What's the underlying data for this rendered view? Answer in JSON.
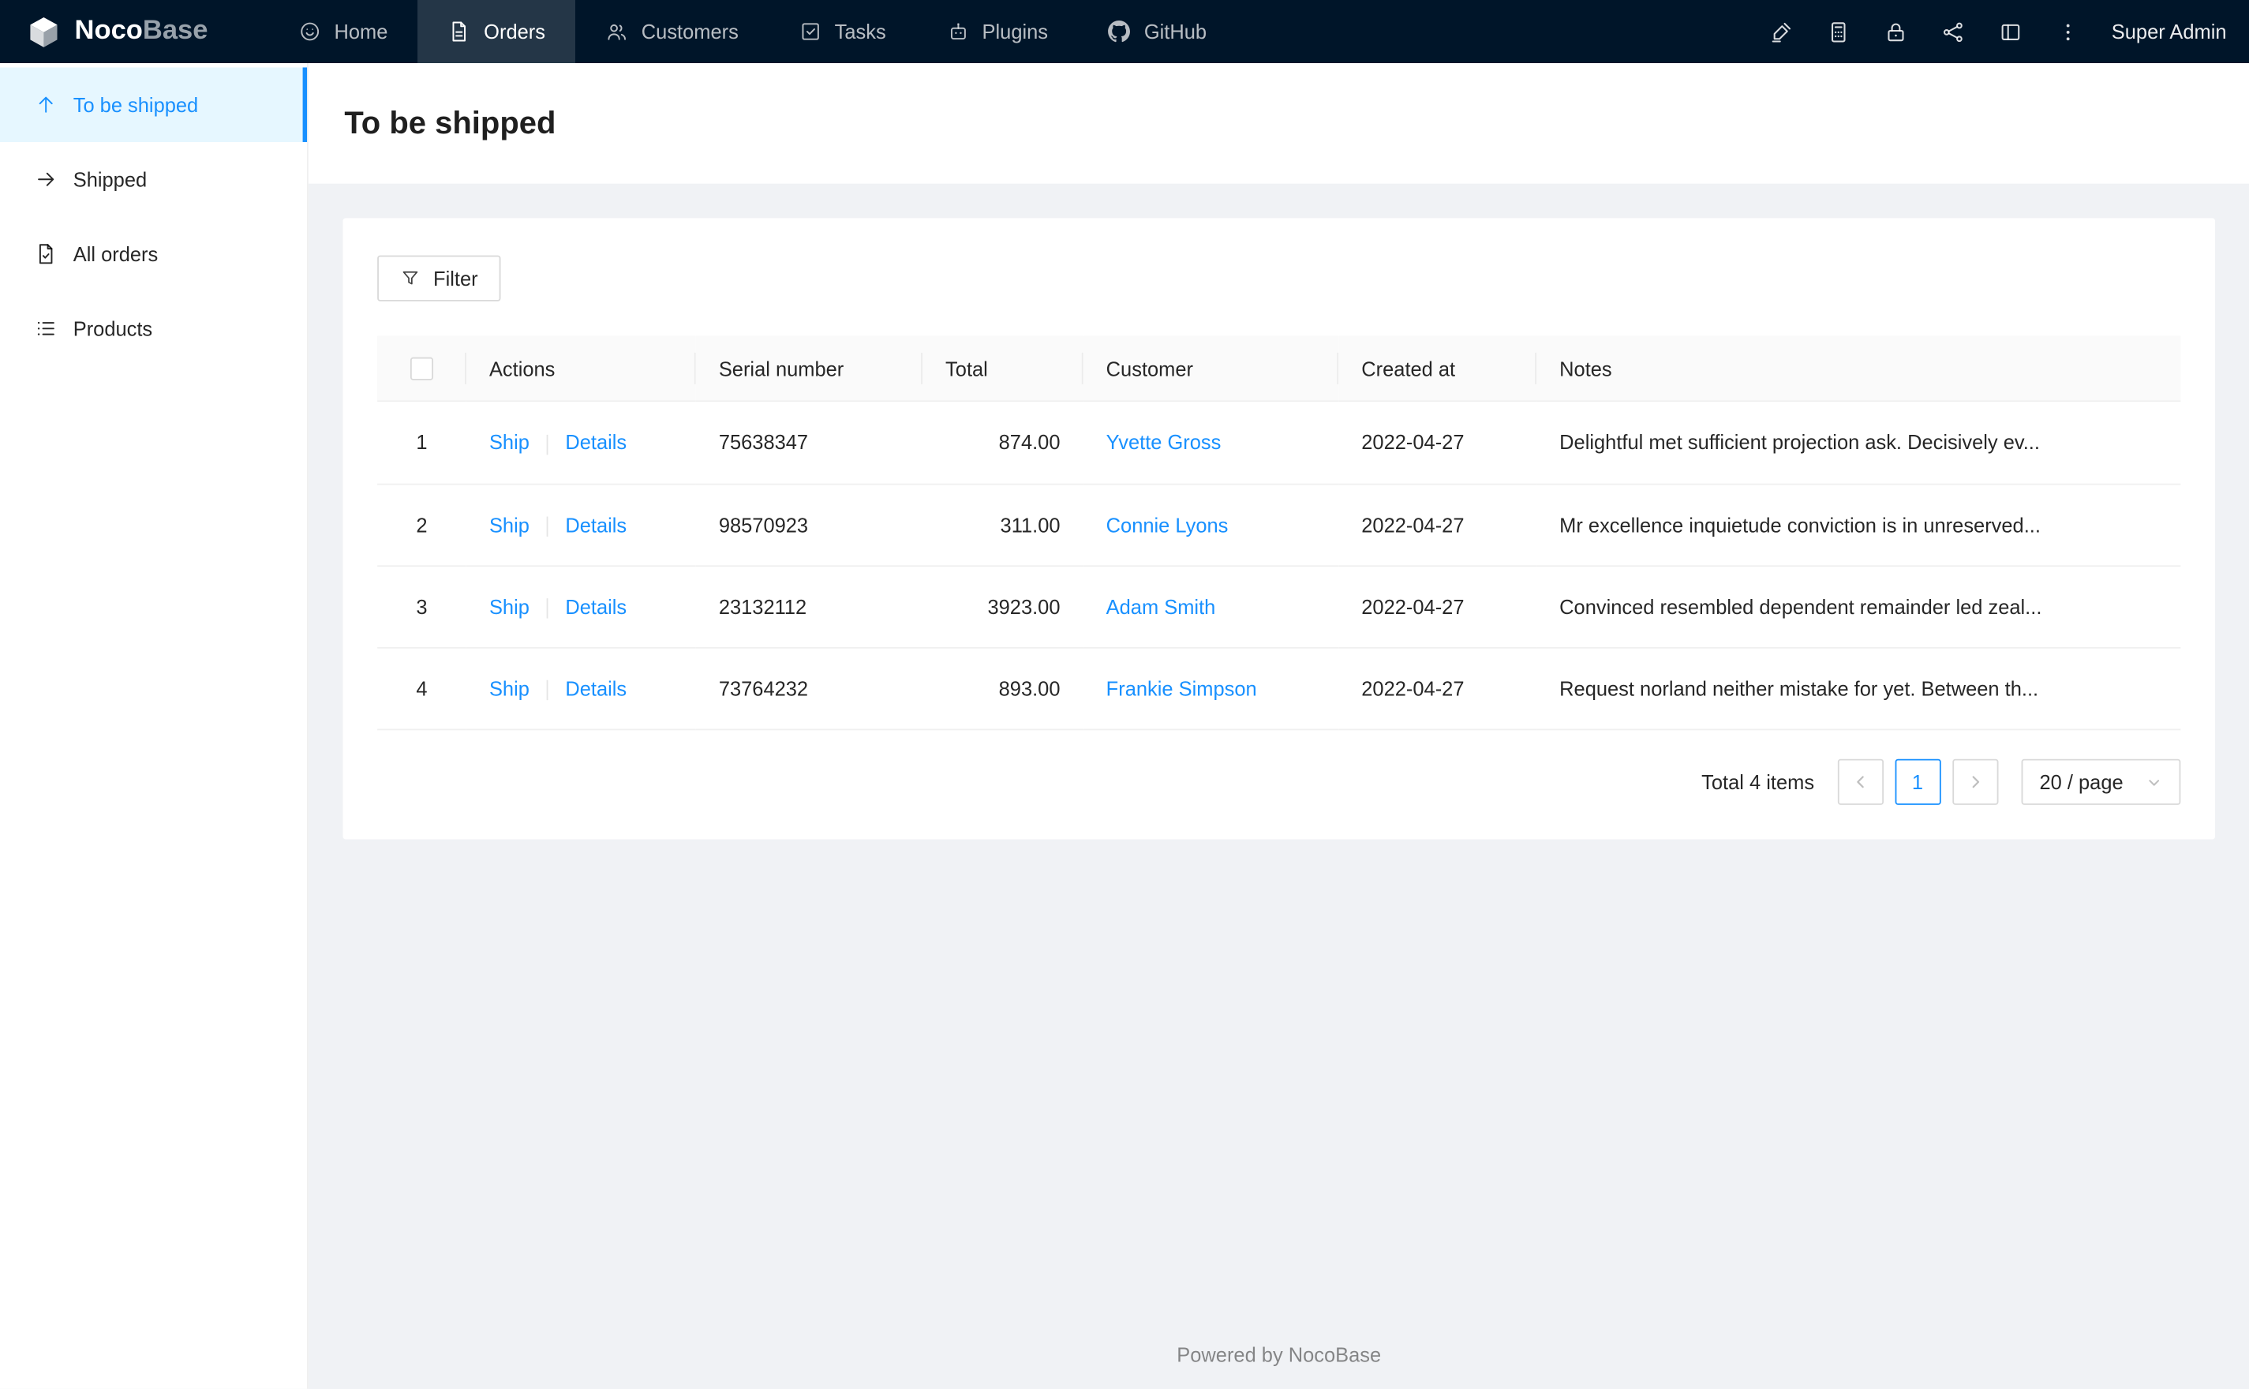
{
  "navbar": {
    "logo": {
      "part1": "Noco",
      "part2": "Base",
      "icon": "nocobase-logo-icon"
    },
    "items": [
      {
        "label": "Home",
        "icon": "home-icon",
        "active": false
      },
      {
        "label": "Orders",
        "icon": "orders-icon",
        "active": true
      },
      {
        "label": "Customers",
        "icon": "customers-icon",
        "active": false
      },
      {
        "label": "Tasks",
        "icon": "tasks-icon",
        "active": false
      },
      {
        "label": "Plugins",
        "icon": "plugins-icon",
        "active": false
      },
      {
        "label": "GitHub",
        "icon": "github-icon",
        "active": false
      }
    ],
    "right_icons": [
      "highlighter-icon",
      "calculator-icon",
      "lock-icon",
      "collaboration-icon",
      "layout-icon",
      "more-icon"
    ],
    "user_label": "Super Admin"
  },
  "sidebar": {
    "items": [
      {
        "label": "To be shipped",
        "icon": "arrow-up-icon",
        "active": true
      },
      {
        "label": "Shipped",
        "icon": "arrow-right-icon",
        "active": false
      },
      {
        "label": "All orders",
        "icon": "file-done-icon",
        "active": false
      },
      {
        "label": "Products",
        "icon": "list-icon",
        "active": false
      }
    ]
  },
  "page": {
    "title": "To be shipped"
  },
  "toolbar": {
    "filter_label": "Filter"
  },
  "table": {
    "headers": [
      "Actions",
      "Serial number",
      "Total",
      "Customer",
      "Created at",
      "Notes"
    ],
    "actions": {
      "ship": "Ship",
      "details": "Details"
    },
    "rows": [
      {
        "index": "1",
        "serial": "75638347",
        "total": "874.00",
        "customer": "Yvette Gross",
        "created": "2022-04-27",
        "notes": "Delightful met sufficient projection ask. Decisively ev..."
      },
      {
        "index": "2",
        "serial": "98570923",
        "total": "311.00",
        "customer": "Connie Lyons",
        "created": "2022-04-27",
        "notes": "Mr excellence inquietude conviction is in unreserved..."
      },
      {
        "index": "3",
        "serial": "23132112",
        "total": "3923.00",
        "customer": "Adam Smith",
        "created": "2022-04-27",
        "notes": "Convinced resembled dependent remainder led zeal..."
      },
      {
        "index": "4",
        "serial": "73764232",
        "total": "893.00",
        "customer": "Frankie Simpson",
        "created": "2022-04-27",
        "notes": "Request norland neither mistake for yet. Between th..."
      }
    ]
  },
  "pagination": {
    "total_text": "Total 4 items",
    "current_page": "1",
    "page_size": "20 / page"
  },
  "footer": {
    "text": "Powered by NocoBase"
  },
  "colors": {
    "primary": "#1890ff",
    "navbar_bg": "#001529",
    "navbar_active_bg": "rgba(255,255,255,0.14)",
    "sidebar_active_bg": "#e6f7ff",
    "content_bg": "#f0f2f5",
    "link": "#1890ff"
  }
}
